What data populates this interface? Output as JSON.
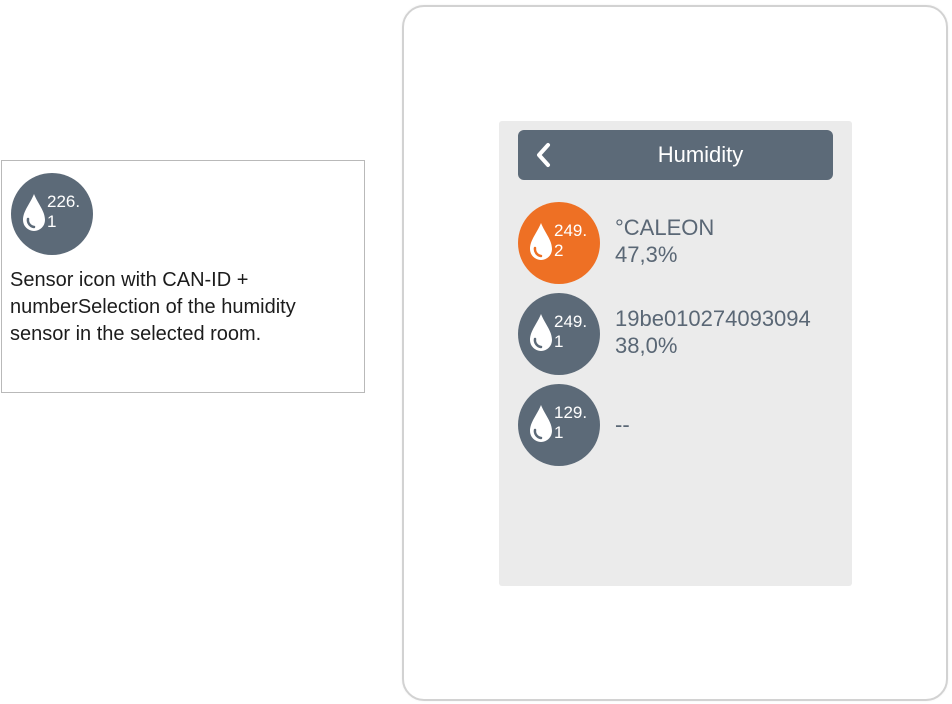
{
  "legend": {
    "icon": {
      "name": "humidity-drop-icon",
      "id_line1": "226.",
      "id_line2": "1"
    },
    "description": "Sensor icon with CAN-ID +\nnumberSelection of the humidity\nsensor in the selected room."
  },
  "screen": {
    "header": {
      "back_icon": "chevron-left-icon",
      "title": "Humidity"
    },
    "sensors": [
      {
        "id_line1": "249.",
        "id_line2": "2",
        "name": "°CALEON",
        "value": "47,3%",
        "selected": true
      },
      {
        "id_line1": "249.",
        "id_line2": "1",
        "name": "19be010274093094",
        "value": "38,0%",
        "selected": false
      },
      {
        "id_line1": "129.",
        "id_line2": "1",
        "name": "--",
        "value": "",
        "selected": false
      }
    ]
  },
  "colors": {
    "icon_default": "#5c6a78",
    "icon_selected": "#ee7024",
    "header_bar": "#5c6a78",
    "screen_background": "#ebebeb",
    "sensor_text": "#5a6775"
  }
}
